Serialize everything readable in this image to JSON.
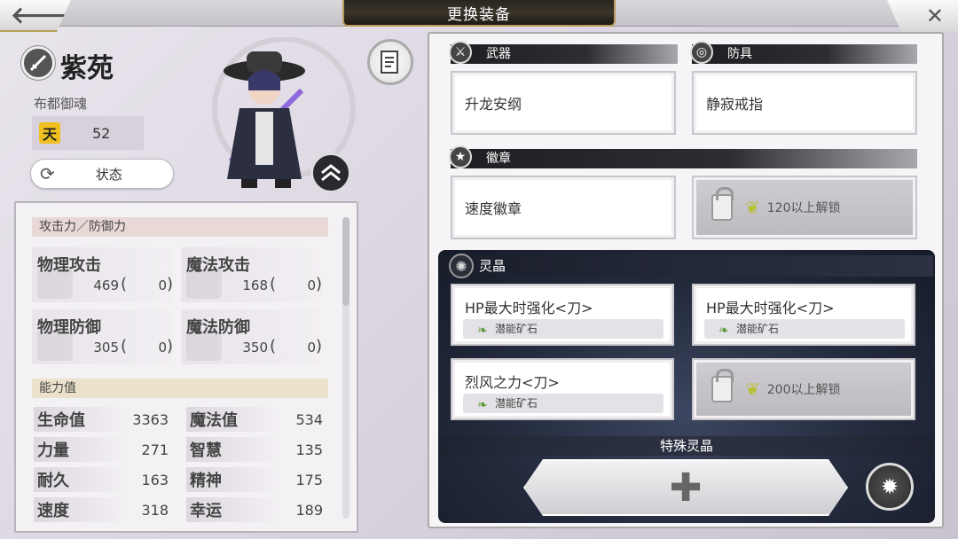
{
  "header": {
    "title": "更换装备",
    "back_icon": "back-arrow-icon",
    "close_icon": "close-icon"
  },
  "character": {
    "name": "紫苑",
    "title": "布都御魂",
    "rank_badge": "天",
    "level": "52",
    "status_button": "状态"
  },
  "stats": {
    "combat_header": "攻击力／防御力",
    "combat": [
      {
        "name": "物理攻击",
        "base": "469",
        "bonus": "0"
      },
      {
        "name": "魔法攻击",
        "base": "168",
        "bonus": "0"
      },
      {
        "name": "物理防御",
        "base": "305",
        "bonus": "0"
      },
      {
        "name": "魔法防御",
        "base": "350",
        "bonus": "0"
      }
    ],
    "ability_header": "能力值",
    "abilities": [
      {
        "name": "生命值",
        "value": "3363"
      },
      {
        "name": "魔法值",
        "value": "534"
      },
      {
        "name": "力量",
        "value": "271"
      },
      {
        "name": "智慧",
        "value": "135"
      },
      {
        "name": "耐久",
        "value": "163"
      },
      {
        "name": "精神",
        "value": "175"
      },
      {
        "name": "速度",
        "value": "318"
      },
      {
        "name": "幸运",
        "value": "189"
      }
    ]
  },
  "equipment": {
    "weapon": {
      "label": "武器",
      "item": "升龙安纲"
    },
    "armor": {
      "label": "防具",
      "item": "静寂戒指"
    },
    "badge": {
      "label": "徽章",
      "item": "速度徽章",
      "locked_slot": "120以上解锁"
    }
  },
  "crystals": {
    "label": "灵晶",
    "slots": [
      {
        "name": "HP最大时强化<刀>",
        "sub": "潜能矿石"
      },
      {
        "name": "HP最大时强化<刀>",
        "sub": "潜能矿石"
      },
      {
        "name": "烈风之力<刀>",
        "sub": "潜能矿石"
      }
    ],
    "locked_slot": "200以上解锁",
    "special_label": "特殊灵晶",
    "add_symbol": "✚"
  },
  "colors": {
    "title_plate": "#2a2620",
    "accent_gold": "#b89a5a",
    "rank_gold": "#f0c020"
  }
}
